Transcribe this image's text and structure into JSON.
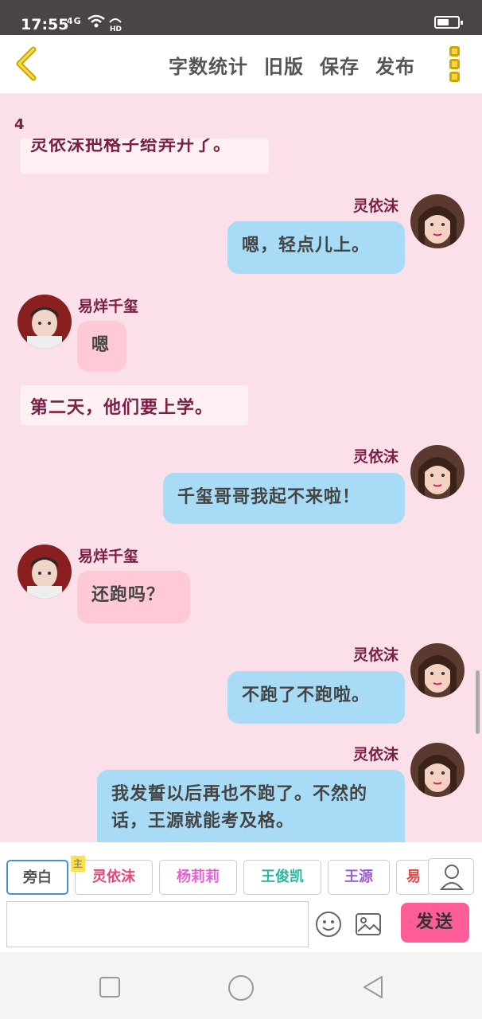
{
  "status": {
    "time": "17:55",
    "network": "4G",
    "hd": "HD"
  },
  "toolbar": {
    "word_count": "字数统计",
    "old_version": "旧版",
    "save": "保存",
    "publish": "发布"
  },
  "chat": {
    "page_number": "4",
    "partial_narration": "灵依沫把格子给弄开了。",
    "messages": [
      {
        "speaker": "灵依沫",
        "text": "嗯，轻点儿上。",
        "side": "right"
      },
      {
        "speaker": "易烊千玺",
        "text": "嗯",
        "side": "left"
      },
      {
        "speaker": "",
        "text": "第二天，他们要上学。",
        "side": "narration"
      },
      {
        "speaker": "灵依沫",
        "text": "千玺哥哥我起不来啦！",
        "side": "right"
      },
      {
        "speaker": "易烊千玺",
        "text": "还跑吗？",
        "side": "left"
      },
      {
        "speaker": "灵依沫",
        "text": "不跑了不跑啦。",
        "side": "right"
      },
      {
        "speaker": "灵依沫",
        "text": "我发誓以后再也不跑了。不然的话，王源就能考及格。",
        "side": "right"
      }
    ]
  },
  "roles": {
    "narrator": "旁白",
    "main_tag": "主",
    "items": [
      {
        "label": "灵依沫",
        "color": "#e8457a"
      },
      {
        "label": "杨莉莉",
        "color": "#e85fd6"
      },
      {
        "label": "王俊凯",
        "color": "#2bb5a3"
      },
      {
        "label": "王源",
        "color": "#9a5fd6"
      },
      {
        "label": "易",
        "color": "#e8454a"
      }
    ]
  },
  "input": {
    "placeholder": "",
    "send_label": "发送"
  },
  "colors": {
    "background": "#fbe0ea",
    "bubble_right": "#a8dcf6",
    "bubble_left": "#ffc9d6",
    "send": "#ff5d97"
  }
}
